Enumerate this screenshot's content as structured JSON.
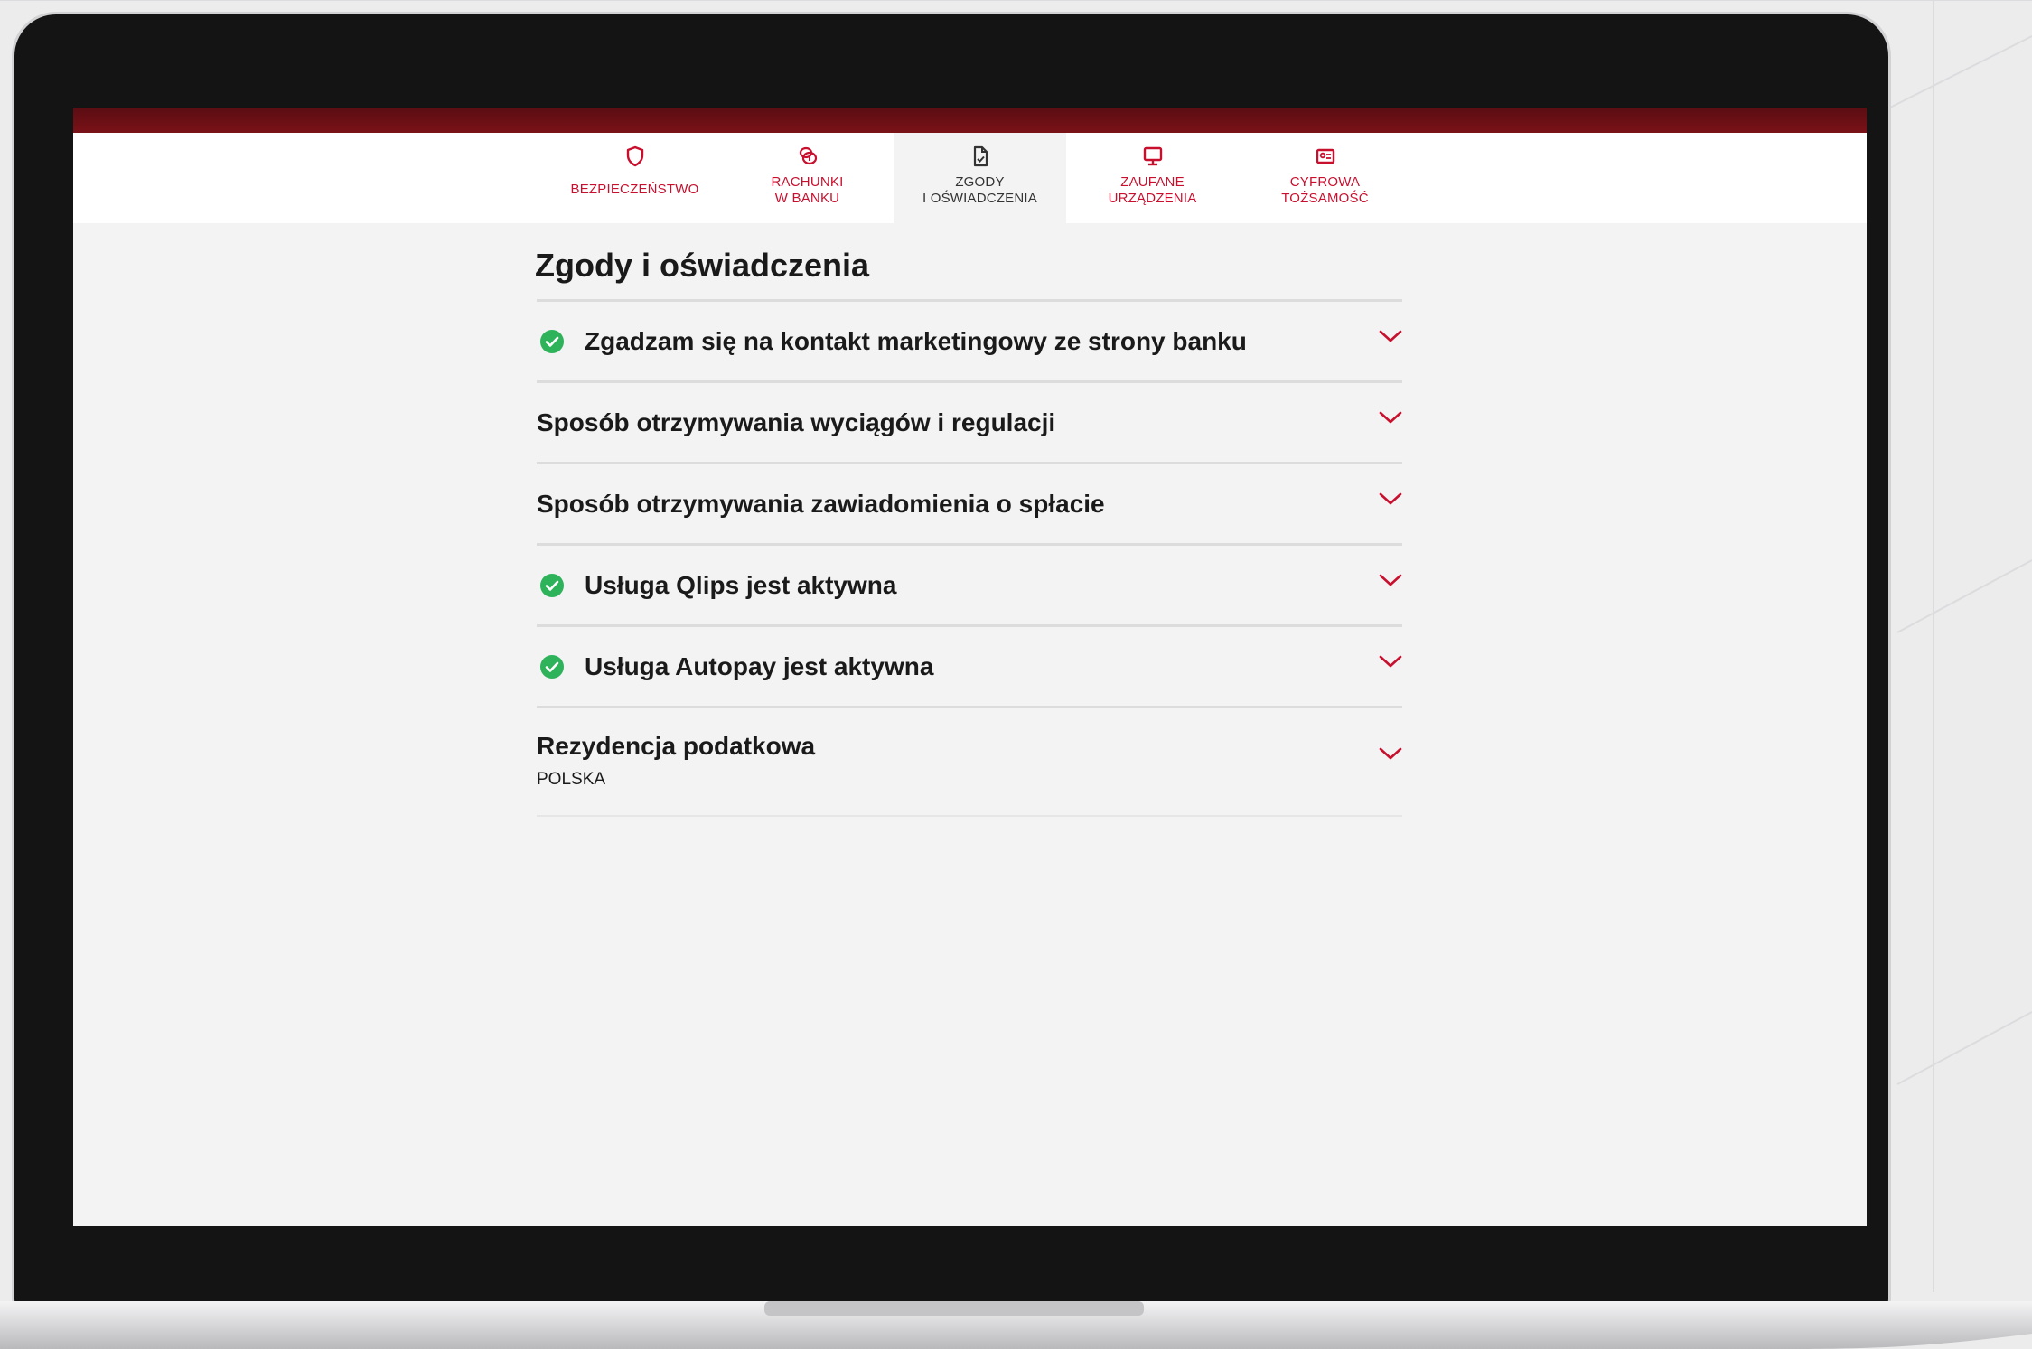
{
  "nav": {
    "tabs": [
      {
        "label": "BEZPIECZEŃSTWO",
        "icon": "shield-icon",
        "active": false
      },
      {
        "label": "RACHUNKI\nW BANKU",
        "icon": "coins-icon",
        "active": false
      },
      {
        "label": "ZGODY\nI OŚWIADCZENIA",
        "icon": "document-icon",
        "active": true
      },
      {
        "label": "ZAUFANE\nURZĄDZENIA",
        "icon": "monitor-icon",
        "active": false
      },
      {
        "label": "CYFROWA\nTOŻSAMOŚĆ",
        "icon": "id-card-icon",
        "active": false
      }
    ]
  },
  "main": {
    "title": "Zgody i oświadczenia",
    "items": [
      {
        "label": "Zgadzam się na kontakt marketingowy ze strony banku",
        "checked": true
      },
      {
        "label": "Sposób otrzymywania wyciągów i regulacji",
        "checked": false
      },
      {
        "label": "Sposób otrzymywania zawiadomienia o spłacie",
        "checked": false
      },
      {
        "label": "Usługa Qlips jest aktywna",
        "checked": true
      },
      {
        "label": "Usługa Autopay jest aktywna",
        "checked": true
      },
      {
        "label": "Rezydencja podatkowa",
        "value": "POLSKA",
        "checked": false
      }
    ]
  },
  "colors": {
    "accent": "#c8102e",
    "check": "#2eb35a",
    "header_stripe": "#6b1016"
  }
}
